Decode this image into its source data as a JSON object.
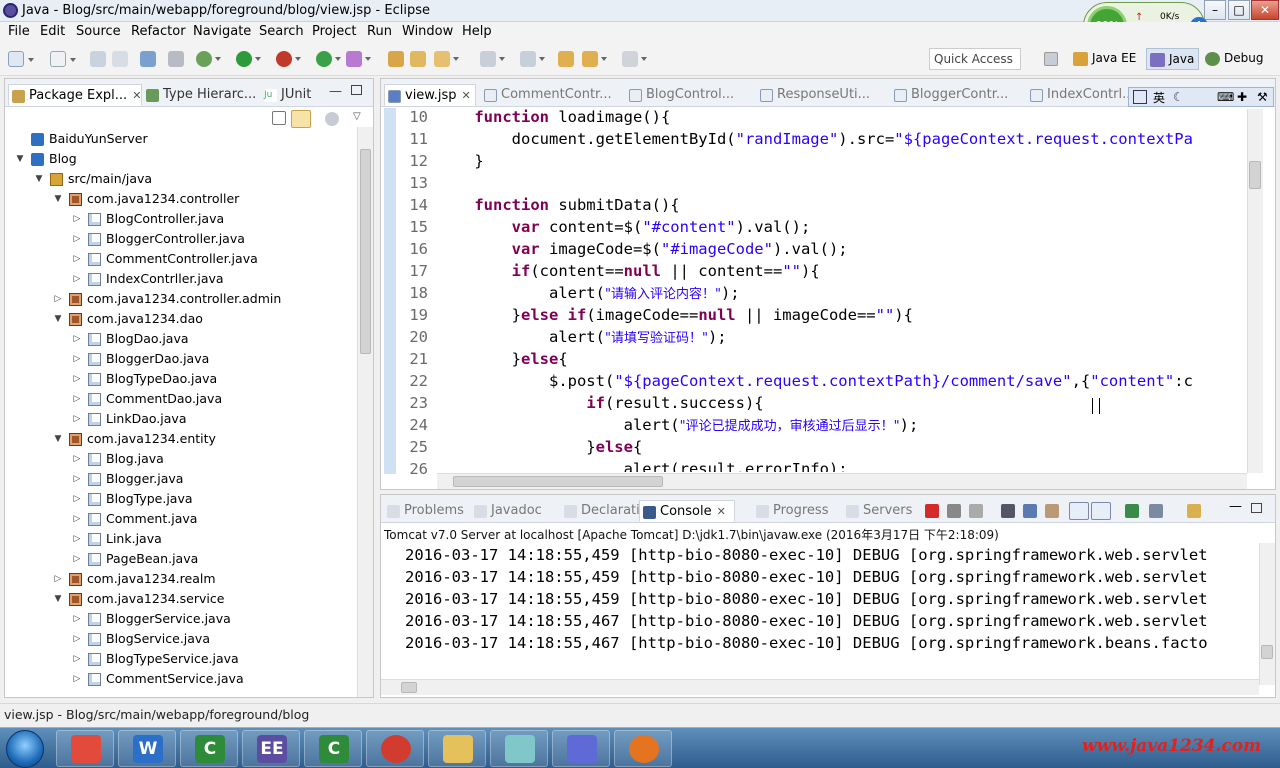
{
  "window": {
    "title": "Java - Blog/src/main/webapp/foreground/blog/view.jsp - Eclipse"
  },
  "menu": [
    "File",
    "Edit",
    "Source",
    "Refactor",
    "Navigate",
    "Search",
    "Project",
    "Run",
    "Window",
    "Help"
  ],
  "toolbar": {
    "quick_access": "Quick Access",
    "perspectives": [
      {
        "label": "Java EE"
      },
      {
        "label": "Java"
      },
      {
        "label": "Debug"
      }
    ]
  },
  "netwidget": {
    "percent": "60%",
    "speed": "0K/s"
  },
  "explorer": {
    "tabs": [
      {
        "label": "Package Expl..."
      },
      {
        "label": "Type Hierarc..."
      },
      {
        "label": "JUnit"
      }
    ],
    "tree": [
      {
        "label": "BaiduYunServer",
        "kind": "proj",
        "depth": 0,
        "arrow": ""
      },
      {
        "label": "Blog",
        "kind": "proj",
        "depth": 0,
        "arrow": "▼"
      },
      {
        "label": "src/main/java",
        "kind": "src",
        "depth": 1,
        "arrow": "▼"
      },
      {
        "label": "com.java1234.controller",
        "kind": "pkg",
        "depth": 2,
        "arrow": "▼"
      },
      {
        "label": "BlogController.java",
        "kind": "java",
        "depth": 3,
        "arrow": "▷"
      },
      {
        "label": "BloggerController.java",
        "kind": "java",
        "depth": 3,
        "arrow": "▷"
      },
      {
        "label": "CommentController.java",
        "kind": "java",
        "depth": 3,
        "arrow": "▷"
      },
      {
        "label": "IndexContrller.java",
        "kind": "java",
        "depth": 3,
        "arrow": "▷"
      },
      {
        "label": "com.java1234.controller.admin",
        "kind": "pkg",
        "depth": 2,
        "arrow": "▷"
      },
      {
        "label": "com.java1234.dao",
        "kind": "pkg",
        "depth": 2,
        "arrow": "▼"
      },
      {
        "label": "BlogDao.java",
        "kind": "java",
        "depth": 3,
        "arrow": "▷"
      },
      {
        "label": "BloggerDao.java",
        "kind": "java",
        "depth": 3,
        "arrow": "▷"
      },
      {
        "label": "BlogTypeDao.java",
        "kind": "java",
        "depth": 3,
        "arrow": "▷"
      },
      {
        "label": "CommentDao.java",
        "kind": "java",
        "depth": 3,
        "arrow": "▷"
      },
      {
        "label": "LinkDao.java",
        "kind": "java",
        "depth": 3,
        "arrow": "▷"
      },
      {
        "label": "com.java1234.entity",
        "kind": "pkg",
        "depth": 2,
        "arrow": "▼"
      },
      {
        "label": "Blog.java",
        "kind": "java",
        "depth": 3,
        "arrow": "▷"
      },
      {
        "label": "Blogger.java",
        "kind": "java",
        "depth": 3,
        "arrow": "▷"
      },
      {
        "label": "BlogType.java",
        "kind": "java",
        "depth": 3,
        "arrow": "▷"
      },
      {
        "label": "Comment.java",
        "kind": "java",
        "depth": 3,
        "arrow": "▷"
      },
      {
        "label": "Link.java",
        "kind": "java",
        "depth": 3,
        "arrow": "▷"
      },
      {
        "label": "PageBean.java",
        "kind": "java",
        "depth": 3,
        "arrow": "▷"
      },
      {
        "label": "com.java1234.realm",
        "kind": "pkg",
        "depth": 2,
        "arrow": "▷"
      },
      {
        "label": "com.java1234.service",
        "kind": "pkg",
        "depth": 2,
        "arrow": "▼"
      },
      {
        "label": "BloggerService.java",
        "kind": "java",
        "depth": 3,
        "arrow": "▷"
      },
      {
        "label": "BlogService.java",
        "kind": "java",
        "depth": 3,
        "arrow": "▷"
      },
      {
        "label": "BlogTypeService.java",
        "kind": "java",
        "depth": 3,
        "arrow": "▷"
      },
      {
        "label": "CommentService.java",
        "kind": "java",
        "depth": 3,
        "arrow": "▷"
      }
    ]
  },
  "editor": {
    "tabs": [
      {
        "label": "view.jsp",
        "active": true
      },
      {
        "label": "CommentContr...",
        "active": false
      },
      {
        "label": "BlogControl...",
        "active": false
      },
      {
        "label": "ResponseUti...",
        "active": false
      },
      {
        "label": "BloggerContr...",
        "active": false
      },
      {
        "label": "IndexContrl...",
        "active": false
      }
    ],
    "ime": "英",
    "lines": [
      {
        "num": "10",
        "code": [
          [
            "t",
            "    "
          ],
          [
            "kw",
            "function"
          ],
          [
            "t",
            " loadimage(){"
          ]
        ]
      },
      {
        "num": "11",
        "code": [
          [
            "t",
            "        document.getElementById("
          ],
          [
            "str",
            "\"randImage\""
          ],
          [
            "t",
            ").src="
          ],
          [
            "str",
            "\"${pageContext.request.contextPa"
          ]
        ]
      },
      {
        "num": "12",
        "code": [
          [
            "t",
            "    }"
          ]
        ]
      },
      {
        "num": "13",
        "code": [
          [
            "t",
            ""
          ]
        ]
      },
      {
        "num": "14",
        "code": [
          [
            "t",
            "    "
          ],
          [
            "kw",
            "function"
          ],
          [
            "t",
            " submitData(){"
          ]
        ]
      },
      {
        "num": "15",
        "code": [
          [
            "t",
            "        "
          ],
          [
            "kw",
            "var"
          ],
          [
            "t",
            " content=$("
          ],
          [
            "str",
            "\"#content\""
          ],
          [
            "t",
            ").val();"
          ]
        ]
      },
      {
        "num": "16",
        "code": [
          [
            "t",
            "        "
          ],
          [
            "kw",
            "var"
          ],
          [
            "t",
            " imageCode=$("
          ],
          [
            "str",
            "\"#imageCode\""
          ],
          [
            "t",
            ").val();"
          ]
        ]
      },
      {
        "num": "17",
        "code": [
          [
            "t",
            "        "
          ],
          [
            "kw",
            "if"
          ],
          [
            "t",
            "(content=="
          ],
          [
            "kw",
            "null"
          ],
          [
            "t",
            " || content=="
          ],
          [
            "str",
            "\"\""
          ],
          [
            "t",
            "){"
          ]
        ]
      },
      {
        "num": "18",
        "code": [
          [
            "t",
            "            alert("
          ],
          [
            "strcn",
            "\"请输入评论内容！\""
          ],
          [
            "t",
            ");"
          ]
        ]
      },
      {
        "num": "19",
        "code": [
          [
            "t",
            "        }"
          ],
          [
            "kw",
            "else if"
          ],
          [
            "t",
            "(imageCode=="
          ],
          [
            "kw",
            "null"
          ],
          [
            "t",
            " || imageCode=="
          ],
          [
            "str",
            "\"\""
          ],
          [
            "t",
            "){"
          ]
        ]
      },
      {
        "num": "20",
        "code": [
          [
            "t",
            "            alert("
          ],
          [
            "strcn",
            "\"请填写验证码！\""
          ],
          [
            "t",
            ");"
          ]
        ]
      },
      {
        "num": "21",
        "code": [
          [
            "t",
            "        }"
          ],
          [
            "kw",
            "else"
          ],
          [
            "t",
            "{"
          ]
        ]
      },
      {
        "num": "22",
        "code": [
          [
            "t",
            "            $.post("
          ],
          [
            "str",
            "\"${pageContext.request.contextPath}/comment/save\""
          ],
          [
            "t",
            ",{"
          ],
          [
            "str",
            "\"content\""
          ],
          [
            "t",
            ":c"
          ]
        ]
      },
      {
        "num": "23",
        "code": [
          [
            "t",
            "                "
          ],
          [
            "kw",
            "if"
          ],
          [
            "t",
            "(result.success){"
          ]
        ]
      },
      {
        "num": "24",
        "code": [
          [
            "t",
            "                    alert("
          ],
          [
            "strcn",
            "\"评论已提成成功，审核通过后显示！\""
          ],
          [
            "t",
            ");"
          ]
        ]
      },
      {
        "num": "25",
        "code": [
          [
            "t",
            "                }"
          ],
          [
            "kw",
            "else"
          ],
          [
            "t",
            "{"
          ]
        ]
      },
      {
        "num": "26",
        "code": [
          [
            "t",
            "                    alert(result.errorInfo);"
          ]
        ]
      }
    ]
  },
  "bottom": {
    "tabs": [
      {
        "label": "Problems",
        "active": false
      },
      {
        "label": "Javadoc",
        "active": false
      },
      {
        "label": "Declaration",
        "active": false
      },
      {
        "label": "Console",
        "active": true
      },
      {
        "label": "Progress",
        "active": false
      },
      {
        "label": "Servers",
        "active": false
      }
    ],
    "console_header": "Tomcat v7.0 Server at localhost [Apache Tomcat] D:\\jdk1.7\\bin\\javaw.exe (2016年3月17日 下午2:18:09)",
    "lines": [
      "2016-03-17 14:18:55,459 [http-bio-8080-exec-10] DEBUG [org.springframework.web.servlet",
      "2016-03-17 14:18:55,459 [http-bio-8080-exec-10] DEBUG [org.springframework.web.servlet",
      "2016-03-17 14:18:55,459 [http-bio-8080-exec-10] DEBUG [org.springframework.web.servlet",
      "2016-03-17 14:18:55,467 [http-bio-8080-exec-10] DEBUG [org.springframework.web.servlet",
      "2016-03-17 14:18:55,467 [http-bio-8080-exec-10] DEBUG [org.springframework.beans.facto"
    ]
  },
  "statusbar": {
    "text": "view.jsp - Blog/src/main/webapp/foreground/blog"
  },
  "taskbar": {
    "apps": [
      {
        "name": "colorful-app-icon",
        "glyph": "",
        "color": "#e24a3b"
      },
      {
        "name": "word-icon",
        "glyph": "W",
        "color": "#2b6fc9"
      },
      {
        "name": "camtasia-icon",
        "glyph": "C",
        "color": "#2e8b3a"
      },
      {
        "name": "eclipse-ee-icon",
        "glyph": "EE",
        "color": "#5b4da0"
      },
      {
        "name": "camtasia-recorder-icon",
        "glyph": "C",
        "color": "#2e8b3a"
      },
      {
        "name": "chrome-icon",
        "glyph": "",
        "color": "#d23c2f"
      },
      {
        "name": "folder-icon",
        "glyph": "",
        "color": "#e5c15c"
      },
      {
        "name": "notes-icon",
        "glyph": "",
        "color": "#7fc7c9"
      },
      {
        "name": "player-icon",
        "glyph": "",
        "color": "#5f6ad6"
      },
      {
        "name": "firefox-icon",
        "glyph": "",
        "color": "#e57420"
      }
    ],
    "watermark": "www.java1234.com"
  }
}
